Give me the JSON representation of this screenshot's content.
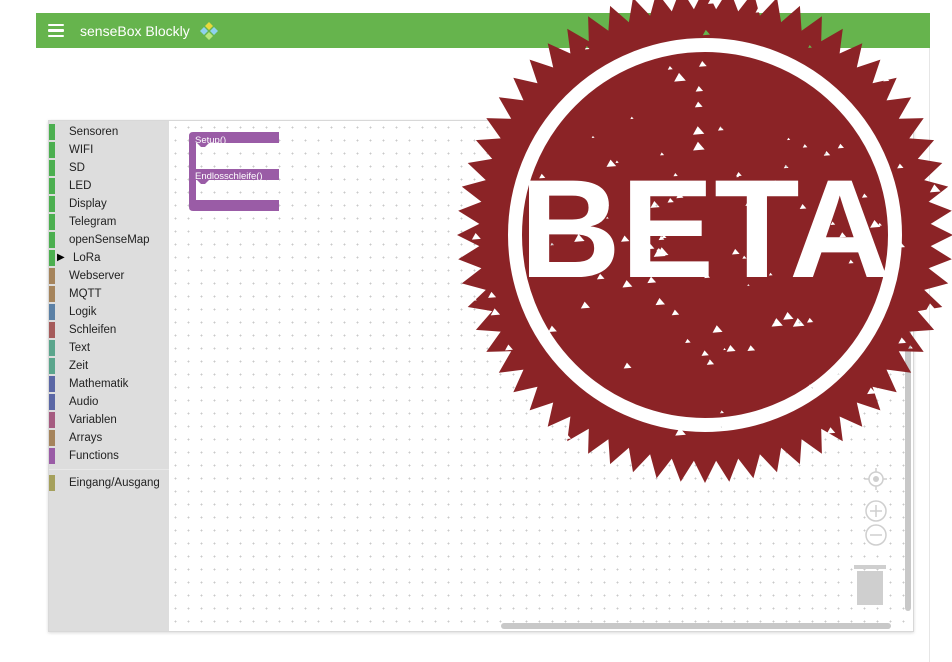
{
  "app": {
    "title": "senseBox Blockly"
  },
  "toolbox": {
    "items": [
      {
        "label": "Sensoren",
        "color": "#4caf50"
      },
      {
        "label": "WIFI",
        "color": "#4caf50"
      },
      {
        "label": "SD",
        "color": "#4caf50"
      },
      {
        "label": "LED",
        "color": "#4caf50"
      },
      {
        "label": "Display",
        "color": "#4caf50"
      },
      {
        "label": "Telegram",
        "color": "#4caf50"
      },
      {
        "label": "openSenseMap",
        "color": "#4caf50"
      },
      {
        "label": "LoRa",
        "color": "#4caf50",
        "expandable": true
      },
      {
        "label": "Webserver",
        "color": "#a5845c"
      },
      {
        "label": "MQTT",
        "color": "#a5845c"
      },
      {
        "label": "Logik",
        "color": "#5b80a5"
      },
      {
        "label": "Schleifen",
        "color": "#a55b5b"
      },
      {
        "label": "Text",
        "color": "#5ba58c"
      },
      {
        "label": "Zeit",
        "color": "#5ba58c"
      },
      {
        "label": "Mathematik",
        "color": "#5b67a5"
      },
      {
        "label": "Audio",
        "color": "#5b67a5"
      },
      {
        "label": "Variablen",
        "color": "#a55b80"
      },
      {
        "label": "Arrays",
        "color": "#a5845c"
      },
      {
        "label": "Functions",
        "color": "#9a5ca6"
      }
    ],
    "extra_items": [
      {
        "label": "Eingang/Ausgang",
        "color": "#a5a05c"
      }
    ]
  },
  "block": {
    "setup_label": "Setup()",
    "loop_label": "Endlosschleife()",
    "color": "#9a5ca6"
  },
  "stamp": {
    "text": "BETA",
    "color": "#8b2326"
  },
  "controls": {
    "recenter": "recenter-icon",
    "zoom_in": "zoom-in-icon",
    "zoom_out": "zoom-out-icon",
    "trash": "trash-icon"
  }
}
